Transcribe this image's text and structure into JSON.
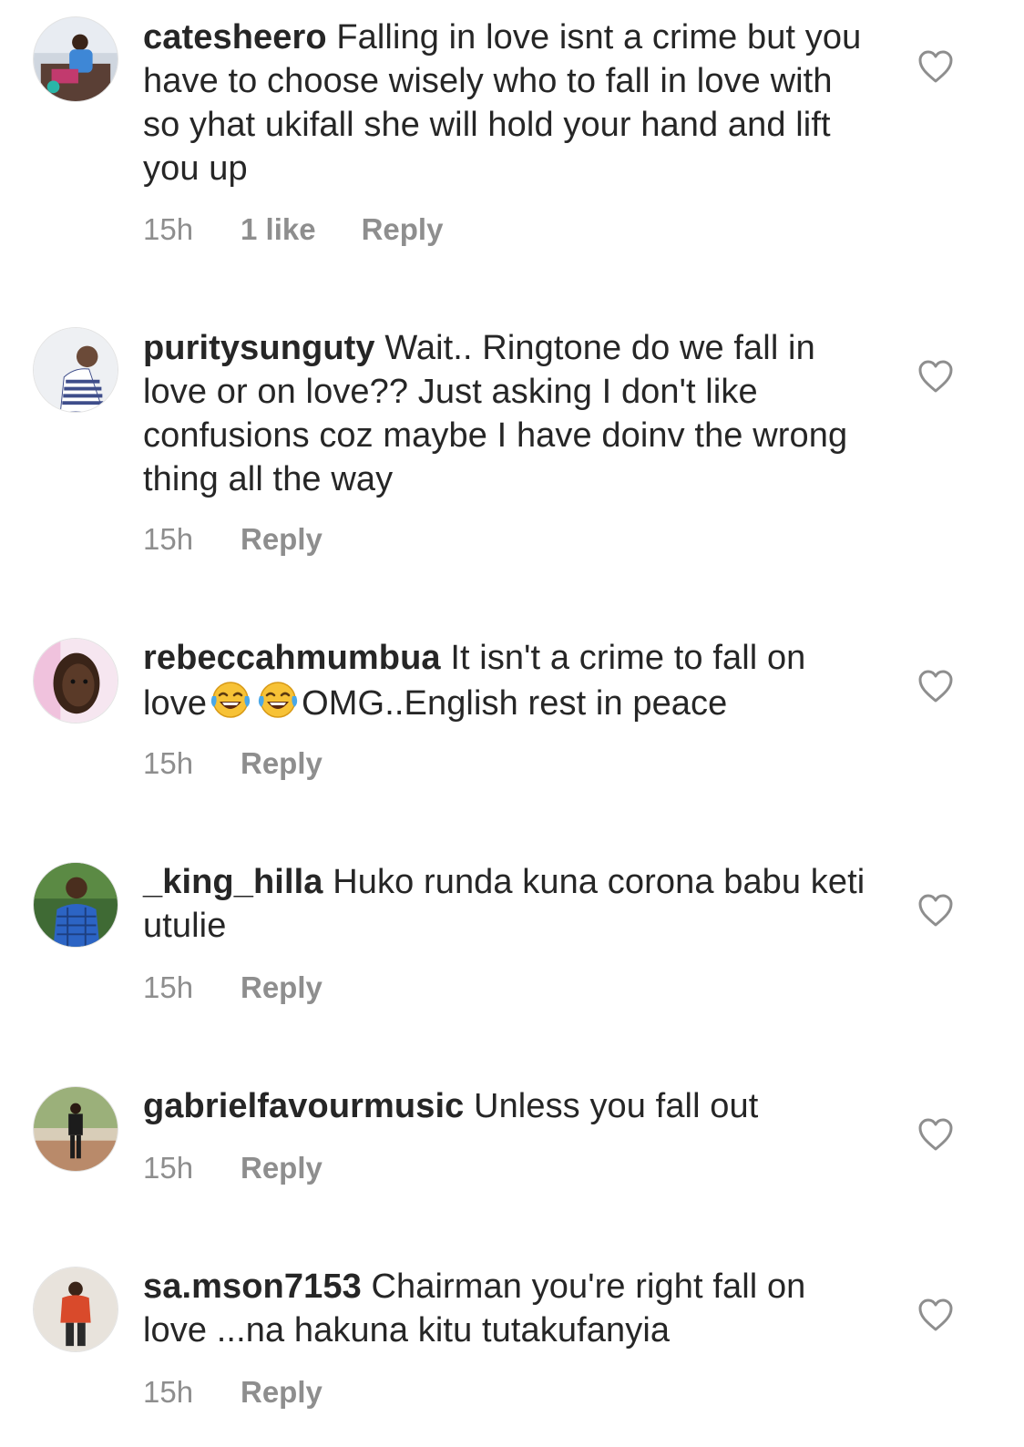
{
  "comments": [
    {
      "username": "catesheero",
      "text": "Falling in love isnt a crime but you have to choose wisely who to fall in love with so yhat ukifall she will hold your hand and lift you up",
      "time": "15h",
      "likes": "1 like",
      "reply": "Reply",
      "avatar_colors": [
        "#4a8fd0",
        "#6a4a3a"
      ]
    },
    {
      "username": "puritysunguty",
      "text": "Wait.. Ringtone do we fall in love or on love?? Just asking I don't like confusions coz maybe I have doinv the wrong thing all the way",
      "time": "15h",
      "reply": "Reply",
      "avatar_colors": [
        "#dfe3ea",
        "#3e4d8a"
      ]
    },
    {
      "username": "rebeccahmumbua",
      "text_before": "It isn't a crime to fall on love",
      "emoji": "face-with-tears-of-joy",
      "text_after": "OMG..English rest in peace",
      "time": "15h",
      "reply": "Reply",
      "avatar_colors": [
        "#f3d0e6",
        "#3a2418"
      ]
    },
    {
      "username": "_king_hilla",
      "text": "Huko runda kuna corona babu keti utulie",
      "time": "15h",
      "reply": "Reply",
      "avatar_colors": [
        "#2f5f2a",
        "#2c64c4"
      ]
    },
    {
      "username": "gabrielfavourmusic",
      "text": "Unless you fall out",
      "time": "15h",
      "reply": "Reply",
      "avatar_colors": [
        "#8fa86a",
        "#1c1c1c"
      ]
    },
    {
      "username": "sa.mson7153",
      "text": "Chairman you're right fall on love ...na hakuna kitu tutakufanyia",
      "time": "15h",
      "reply": "Reply",
      "avatar_colors": [
        "#e6e0d8",
        "#d94a2b"
      ]
    }
  ],
  "icons": {
    "like": "heart-outline-icon",
    "emoji": "face-with-tears-of-joy"
  },
  "colors": {
    "text": "#262626",
    "meta": "#8e8e8e",
    "heart_stroke": "#8e8e8e"
  }
}
